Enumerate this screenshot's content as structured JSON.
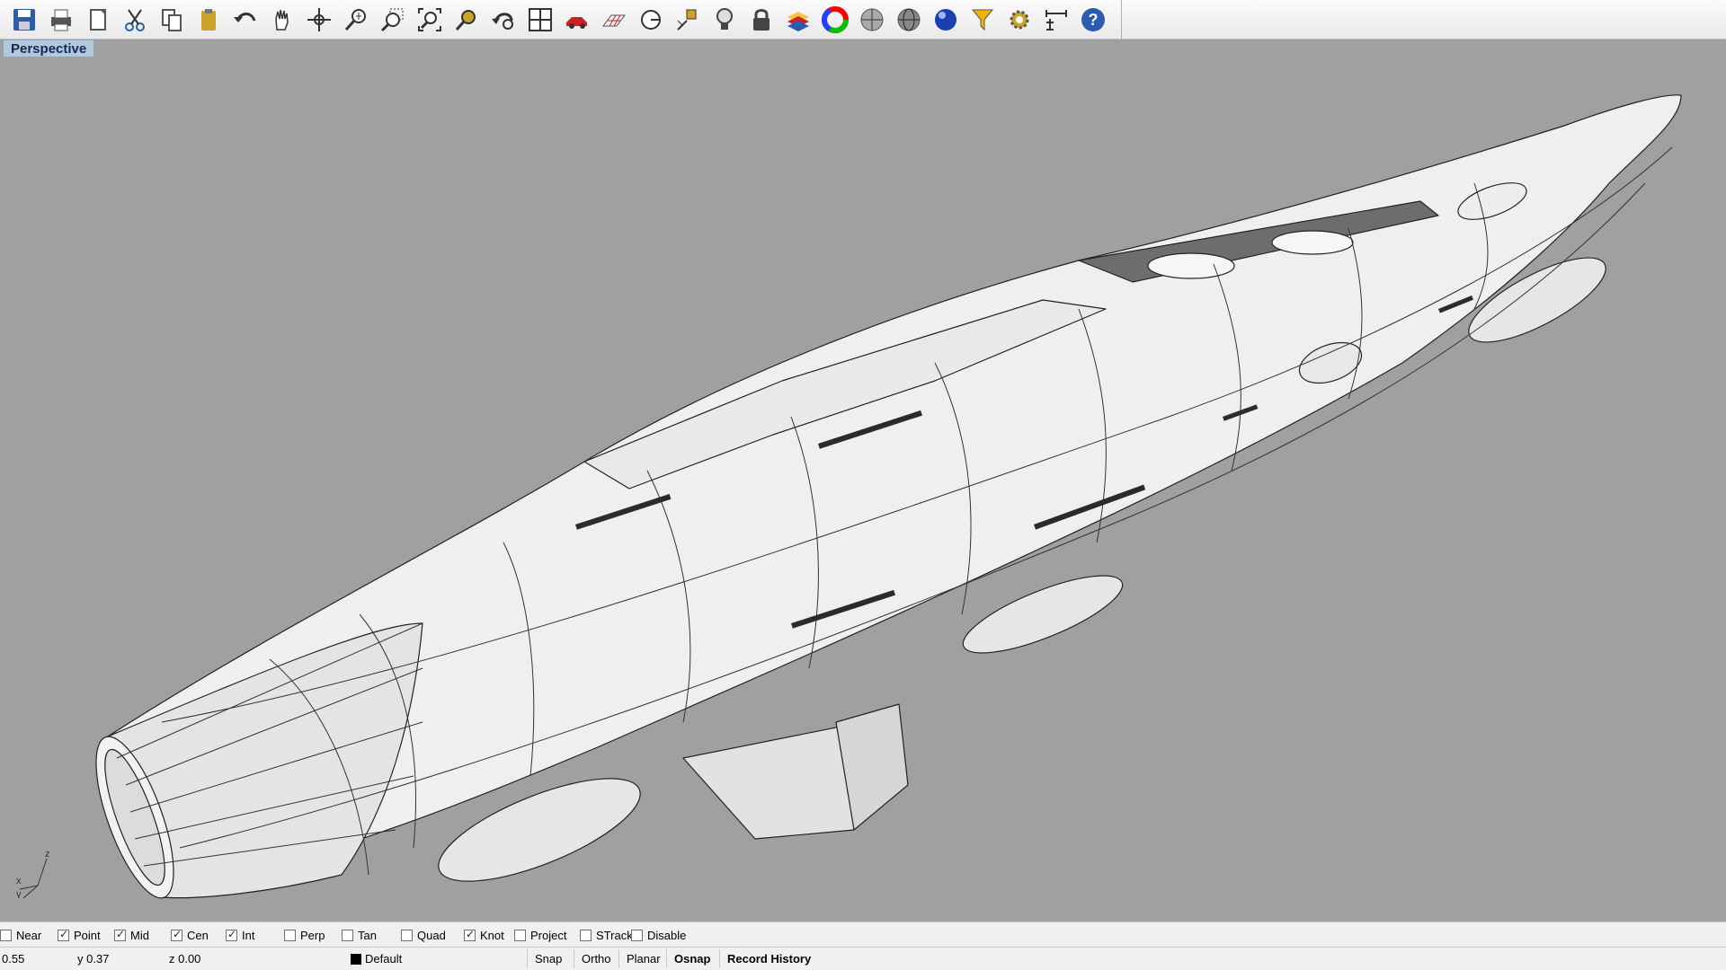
{
  "toolbar": {
    "buttons": [
      {
        "name": "save-icon",
        "color": "#2a5db0"
      },
      {
        "name": "print-icon",
        "color": "#555555"
      },
      {
        "name": "copy-doc-icon",
        "color": "#555555"
      },
      {
        "name": "cut-icon",
        "color": "#2a5db0"
      },
      {
        "name": "copy-icon",
        "color": "#555555"
      },
      {
        "name": "paste-icon",
        "color": "#c9a227"
      },
      {
        "name": "undo-icon",
        "color": "#333333"
      },
      {
        "name": "pan-hand-icon",
        "color": "#333333"
      },
      {
        "name": "rotate-view-icon",
        "color": "#333333"
      },
      {
        "name": "zoom-dynamic-icon",
        "color": "#333333"
      },
      {
        "name": "zoom-window-icon",
        "color": "#333333"
      },
      {
        "name": "zoom-extents-icon",
        "color": "#333333"
      },
      {
        "name": "zoom-selected-icon",
        "color": "#c9a227"
      },
      {
        "name": "undo-view-icon",
        "color": "#333333"
      },
      {
        "name": "four-viewports-icon",
        "color": "#333333"
      },
      {
        "name": "named-view-icon",
        "color": "#cc2222"
      },
      {
        "name": "grid-icon",
        "color": "#cc2222"
      },
      {
        "name": "cplane-icon",
        "color": "#333333"
      },
      {
        "name": "snap-icon",
        "color": "#c9a227"
      },
      {
        "name": "light-bulb-icon",
        "color": "#444444"
      },
      {
        "name": "lock-icon",
        "color": "#444444"
      },
      {
        "name": "layers-icon",
        "color": "#cc2222"
      },
      {
        "name": "color-wheel-icon",
        "color": "#ff0000"
      },
      {
        "name": "shaded-sphere-icon",
        "color": "#555555"
      },
      {
        "name": "wireframe-sphere-icon",
        "color": "#555555"
      },
      {
        "name": "rendered-sphere-icon",
        "color": "#1a3fb0"
      },
      {
        "name": "funnel-icon",
        "color": "#f0b400"
      },
      {
        "name": "options-gear-icon",
        "color": "#c9a227"
      },
      {
        "name": "dimension-icon",
        "color": "#333333"
      },
      {
        "name": "help-icon",
        "color": "#2a5db0"
      }
    ]
  },
  "viewport": {
    "title": "Perspective",
    "background": "#a0a0a0",
    "axis_labels": {
      "x": "x",
      "y": "y",
      "z": "z"
    }
  },
  "osnap": {
    "items": [
      {
        "label": "Near",
        "checked": false
      },
      {
        "label": "Point",
        "checked": true
      },
      {
        "label": "Mid",
        "checked": true
      },
      {
        "label": "Cen",
        "checked": true
      },
      {
        "label": "Int",
        "checked": true
      },
      {
        "label": "Perp",
        "checked": false
      },
      {
        "label": "Tan",
        "checked": false
      },
      {
        "label": "Quad",
        "checked": false
      },
      {
        "label": "Knot",
        "checked": true
      },
      {
        "label": "Project",
        "checked": false
      },
      {
        "label": "STrack",
        "checked": false
      },
      {
        "label": "Disable",
        "checked": false
      }
    ]
  },
  "status": {
    "x": "0.55",
    "y": "y 0.37",
    "z": "z 0.00",
    "layer": "Default",
    "layer_color": "#000000",
    "panes": [
      {
        "label": "Snap",
        "bold": false
      },
      {
        "label": "Ortho",
        "bold": false
      },
      {
        "label": "Planar",
        "bold": false
      },
      {
        "label": "Osnap",
        "bold": true
      },
      {
        "label": "Record History",
        "bold": true
      }
    ]
  }
}
